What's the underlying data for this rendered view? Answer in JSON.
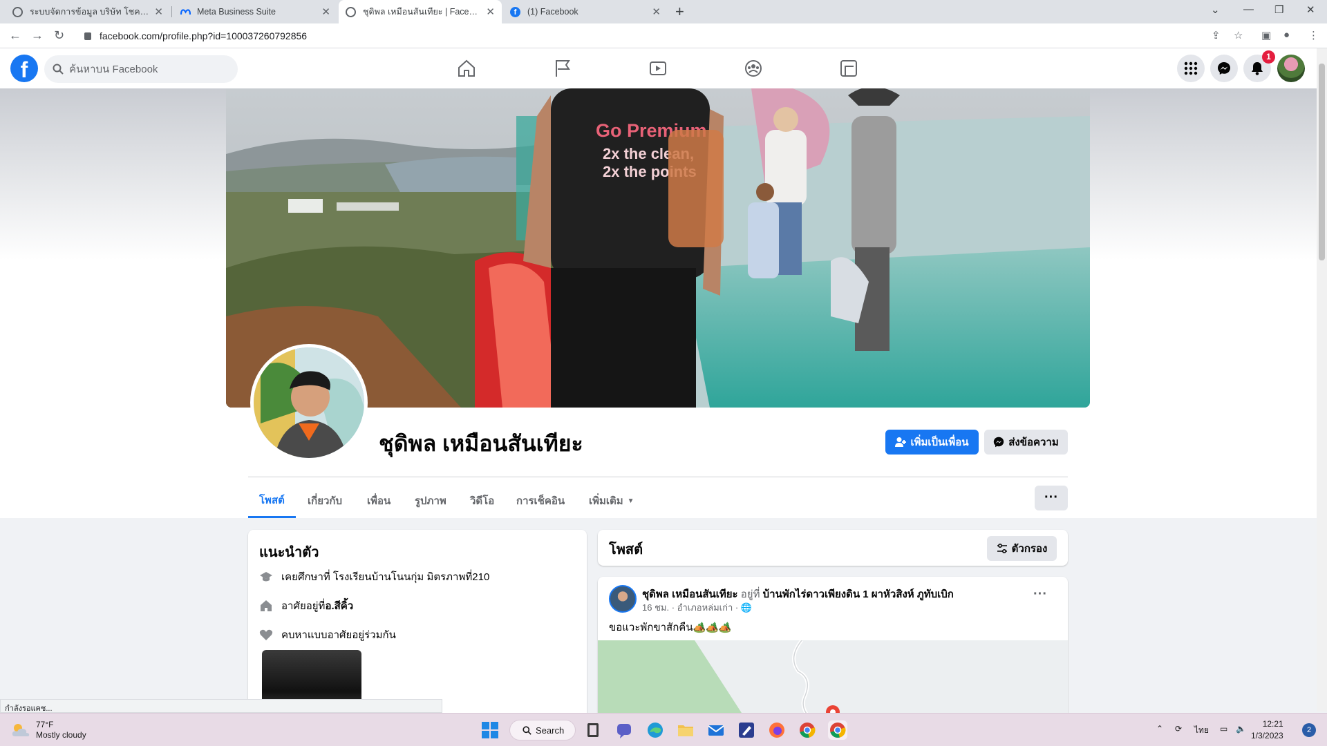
{
  "browser": {
    "tabs": [
      {
        "title": "ระบบจัดการข้อมูล บริษัท โชคลูกน็อต ฯ",
        "active": false
      },
      {
        "title": "Meta Business Suite",
        "active": false
      },
      {
        "title": "ชุดิพล เหมือนสันเทียะ | Facebook",
        "active": true
      },
      {
        "title": "(1) Facebook",
        "active": false
      }
    ],
    "url": "facebook.com/profile.php?id=100037260792856",
    "status_text": "กำลังรอแคช..."
  },
  "fb_header": {
    "logo": "f",
    "search_placeholder": "ค้นหาบน Facebook",
    "nav_icons": [
      "home-icon",
      "pages-flag-icon",
      "watch-video-icon",
      "groups-icon",
      "gaming-icon"
    ],
    "notification_count": "1",
    "accent": "#1877f2"
  },
  "profile": {
    "name": "ชุดิพล เหมือนสันเทียะ",
    "add_friend_label": "เพิ่มเป็นเพื่อน",
    "message_label": "ส่งข้อความ",
    "cover_shirt_text": [
      "Go Premium",
      "2x the clean,",
      "2x the points"
    ],
    "tabs": [
      "โพสต์",
      "เกี่ยวกับ",
      "เพื่อน",
      "รูปภาพ",
      "วิดีโอ",
      "การเช็คอิน",
      "เพิ่มเติม"
    ],
    "more_label": "···"
  },
  "intro": {
    "title": "แนะนำตัว",
    "education": "เคยศึกษาที่ โรงเรียนบ้านโนนกุ่ม มิตรภาพที่210",
    "lives_prefix": "อาศัยอยู่ที่ ",
    "lives_place": "อ.สีคิ้ว",
    "relationship": "คบหาแบบอาศัยอยู่ร่วมกัน"
  },
  "posts": {
    "title": "โพสต์",
    "filter_label": "ตัวกรอง",
    "post": {
      "author": "ชุดิพล เหมือนสันเทียะ",
      "at_label": "อยู่ที่",
      "place": "บ้านพักไร่ดาวเพียงดิน 1 ผาหัวสิงห์ ภูทับเบิก",
      "time": "16 ชม.",
      "location": "อำเภอหล่มเก่า",
      "text": "ขอแวะพักขาสักคืน🏕️🏕️🏕️"
    }
  },
  "taskbar": {
    "temperature": "77°F",
    "weather": "Mostly cloudy",
    "search_label": "Search",
    "language": "ไทย",
    "time": "12:21",
    "date": "1/3/2023",
    "notifications": "2"
  }
}
